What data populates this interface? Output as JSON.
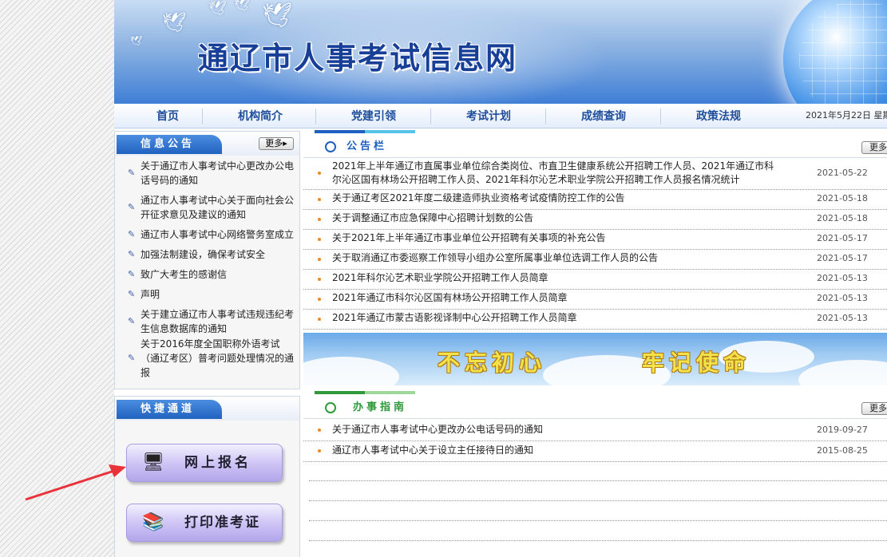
{
  "site": {
    "title": "通辽市人事考试信息网"
  },
  "nav": {
    "items": [
      "首页",
      "机构简介",
      "党建引领",
      "考试计划",
      "成绩查询",
      "政策法规"
    ],
    "date": "2021年5月22日 星期"
  },
  "notice_box": {
    "title": "信息公告",
    "more": "更多",
    "items": [
      "关于通辽市人事考试中心更改办公电话号码的通知",
      "通辽市人事考试中心关于面向社会公开征求意见及建议的通知",
      "通辽市人事考试中心网络警务室成立",
      "加强法制建设，确保考试安全",
      "致广大考生的感谢信",
      "声明",
      "关于建立通辽市人事考试违规违纪考生信息数据库的通知",
      "关于2016年度全国职称外语考试（通辽考区）普考问题处理情况的通报"
    ]
  },
  "quick_box": {
    "title": "快捷通道",
    "buttons": [
      {
        "label": "网上报名",
        "icon": "monitor-pen-icon"
      },
      {
        "label": "打印准考证",
        "icon": "printer-book-icon"
      }
    ]
  },
  "announcements": {
    "title": "公告栏",
    "more": "更多",
    "accent": "#1f5fc2",
    "items": [
      {
        "title": "2021年上半年通辽市直属事业单位综合类岗位、市直卫生健康系统公开招聘工作人员、2021年通辽市科尔沁区国有林场公开招聘工作人员、2021年科尔沁艺术职业学院公开招聘工作人员报名情况统计",
        "date": "2021-05-22"
      },
      {
        "title": "关于通辽考区2021年度二级建造师执业资格考试疫情防控工作的公告",
        "date": "2021-05-18"
      },
      {
        "title": "关于调整通辽市应急保障中心招聘计划数的公告",
        "date": "2021-05-18"
      },
      {
        "title": "关于2021年上半年通辽市事业单位公开招聘有关事项的补充公告",
        "date": "2021-05-17"
      },
      {
        "title": "关于取消通辽市委巡察工作领导小组办公室所属事业单位选调工作人员的公告",
        "date": "2021-05-17"
      },
      {
        "title": "2021年科尔沁艺术职业学院公开招聘工作人员简章",
        "date": "2021-05-13"
      },
      {
        "title": "2021年通辽市科尔沁区国有林场公开招聘工作人员简章",
        "date": "2021-05-13"
      },
      {
        "title": "2021年通辽市蒙古语影视译制中心公开招聘工作人员简章",
        "date": "2021-05-13"
      }
    ]
  },
  "slogan": {
    "left": "不忘初心",
    "right": "牢记使命"
  },
  "guide": {
    "title": "办事指南",
    "more": "更多",
    "accent": "#2f9a3a",
    "items": [
      {
        "title": "关于通辽市人事考试中心更改办公电话号码的通知",
        "date": "2019-09-27"
      },
      {
        "title": "通辽市人事考试中心关于设立主任接待日的通知",
        "date": "2015-08-25"
      }
    ]
  },
  "colors": {
    "nav_text": "#1f4e9c",
    "tab_blue": "#2162c0",
    "bullet": "#f08a1c",
    "arrow": "#e8333a"
  }
}
